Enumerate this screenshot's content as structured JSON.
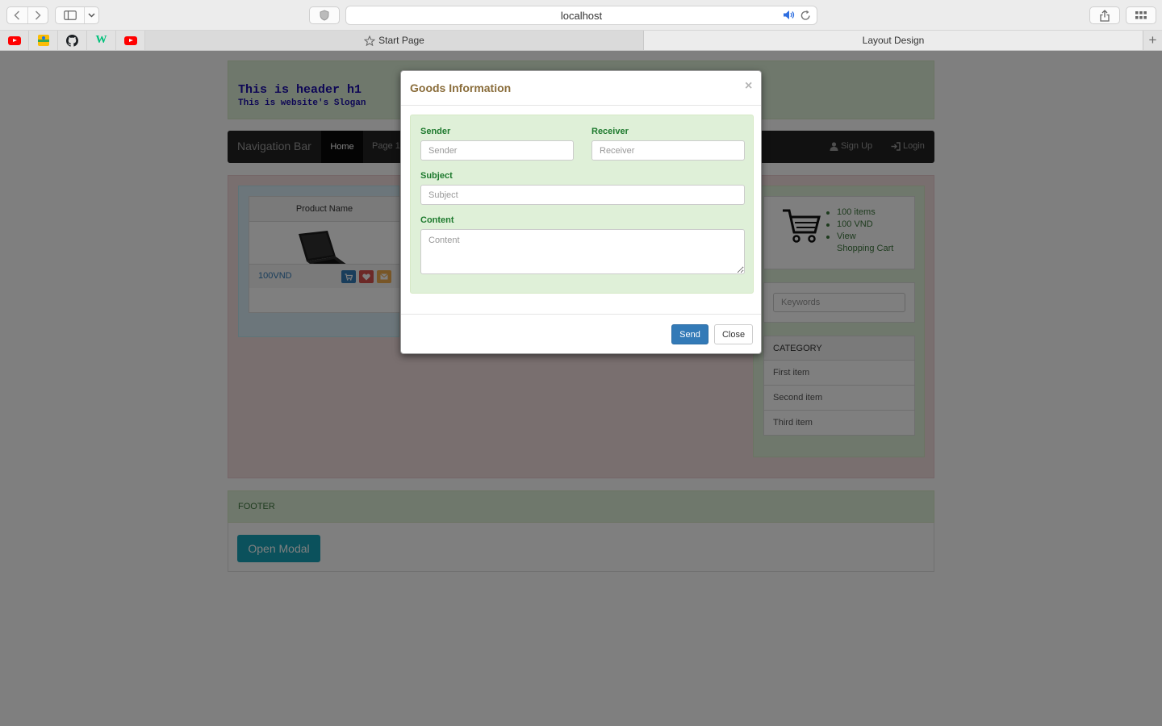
{
  "browser": {
    "url": "localhost",
    "tabs": [
      {
        "label": "Start Page"
      },
      {
        "label": "Layout Design"
      }
    ],
    "favorites": [
      {
        "icon": "youtube-icon"
      },
      {
        "icon": "google-maps-icon"
      },
      {
        "icon": "github-icon"
      },
      {
        "icon": "w-logo-icon"
      },
      {
        "icon": "youtube-icon"
      }
    ]
  },
  "header": {
    "h1": "This is header h1",
    "slogan": "This is website's Slogan"
  },
  "navbar": {
    "brand": "Navigation Bar",
    "items": [
      "Home",
      "Page 1"
    ],
    "signup": "Sign Up",
    "login": "Login"
  },
  "product": {
    "name": "Product Name",
    "price": "100VND"
  },
  "cart": {
    "items": [
      "100 items",
      "100 VND",
      "View",
      "Shopping Cart"
    ]
  },
  "search": {
    "placeholder": "Keywords"
  },
  "category": {
    "heading": "CATEGORY",
    "items": [
      "First item",
      "Second item",
      "Third item"
    ]
  },
  "footer": {
    "label": "FOOTER",
    "open_modal": "Open Modal"
  },
  "modal": {
    "title": "Goods Information",
    "close_x": "×",
    "sender_label": "Sender",
    "sender_placeholder": "Sender",
    "receiver_label": "Receiver",
    "receiver_placeholder": "Receiver",
    "subject_label": "Subject",
    "subject_placeholder": "Subject",
    "content_label": "Content",
    "content_placeholder": "Content",
    "send": "Send",
    "close": "Close"
  },
  "colors": {
    "modal_title": "#8a6d3b",
    "label_green": "#1e7a2e",
    "primary": "#337ab7",
    "open_modal": "#17a2b8"
  }
}
